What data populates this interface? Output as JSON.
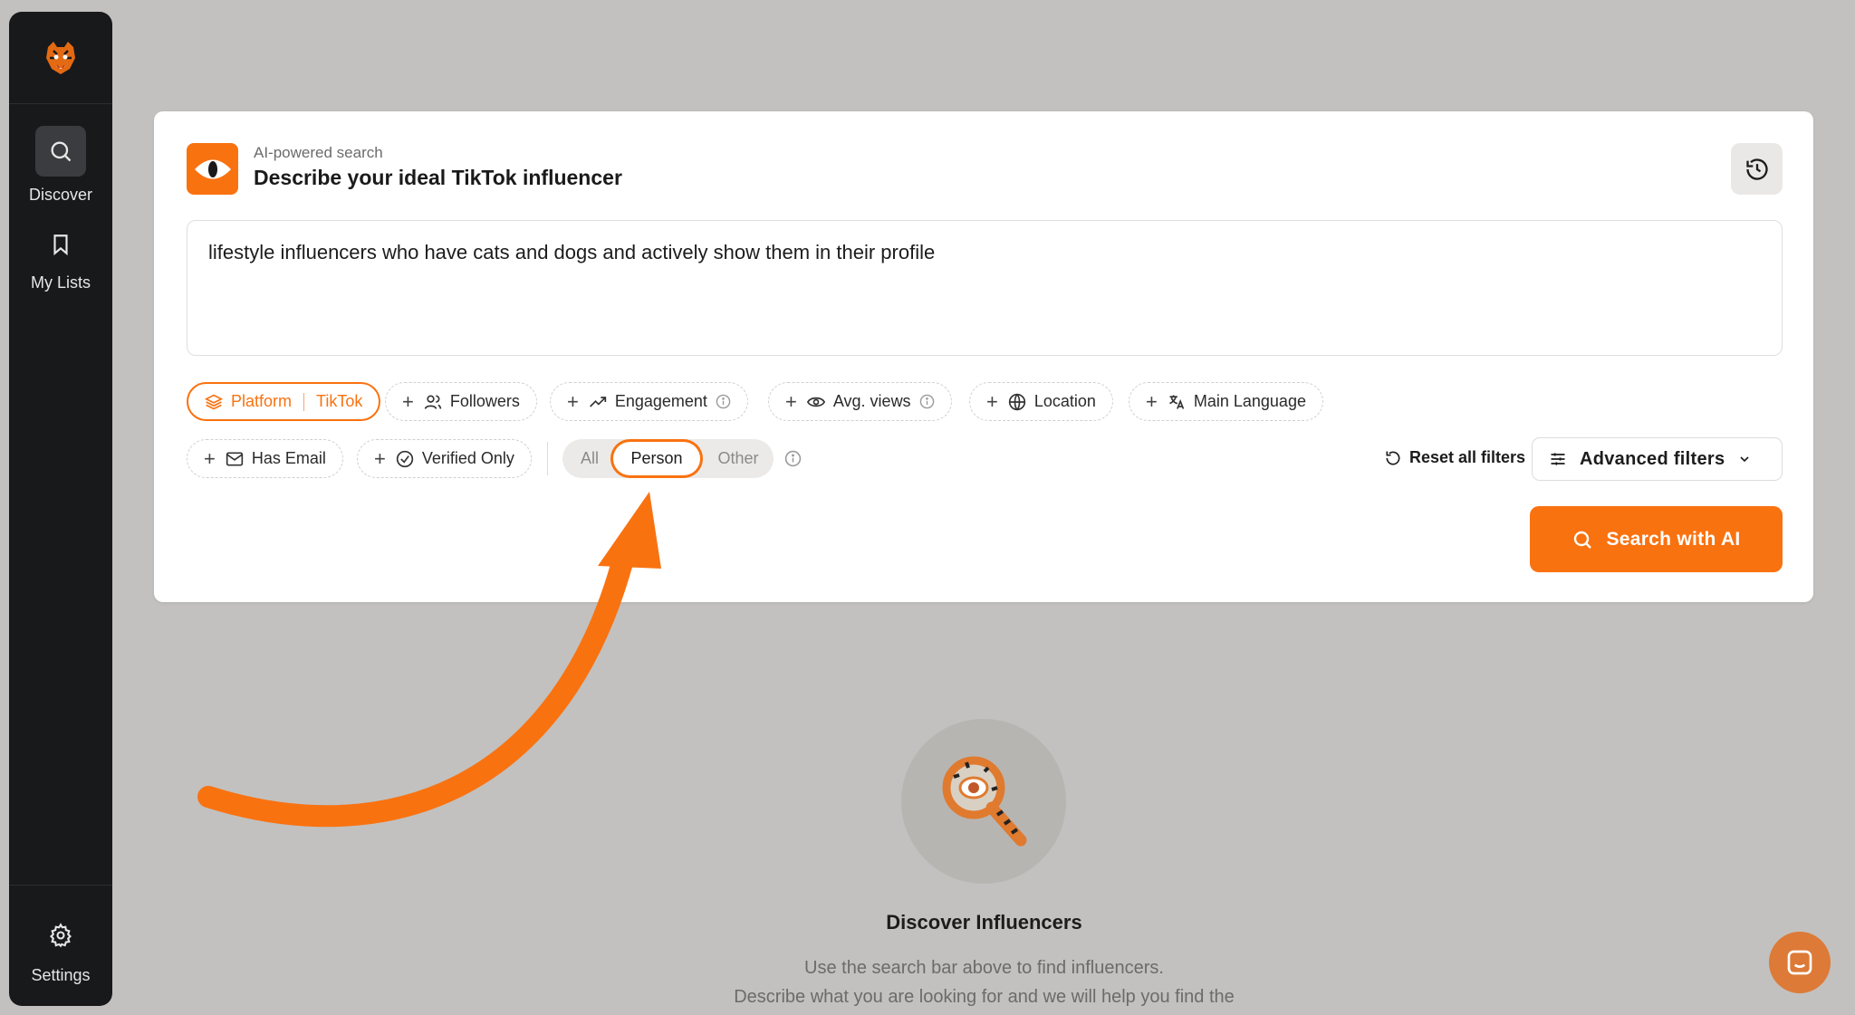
{
  "sidebar": {
    "logo_icon": "tiger-logo-icon",
    "items": [
      {
        "label": "Discover",
        "icon": "search-icon",
        "active": true
      },
      {
        "label": "My Lists",
        "icon": "bookmark-icon",
        "active": false
      },
      {
        "label": "Settings",
        "icon": "gear-icon",
        "active": false
      }
    ]
  },
  "search": {
    "subtitle": "AI-powered search",
    "title": "Describe your ideal TikTok influencer",
    "query": "lifestyle influencers who have cats and dogs and actively show them in their profile"
  },
  "filters": {
    "platform": {
      "label": "Platform",
      "value": "TikTok"
    },
    "row1": [
      "Followers",
      "Engagement",
      "Avg. views",
      "Location",
      "Main Language"
    ],
    "row2": [
      "Has Email",
      "Verified Only"
    ],
    "account_type": {
      "options": [
        "All",
        "Person",
        "Other"
      ],
      "selected": "Person"
    },
    "reset_label": "Reset all filters",
    "advanced_label": "Advanced filters"
  },
  "search_button": "Search with AI",
  "empty_state": {
    "title": "Discover Influencers",
    "line1": "Use the search bar above to find influencers.",
    "line2": "Describe what you are looking for and we will help you find the"
  },
  "colors": {
    "accent": "#f97210",
    "sidebar": "#18191b",
    "background": "#c2c1bf"
  }
}
